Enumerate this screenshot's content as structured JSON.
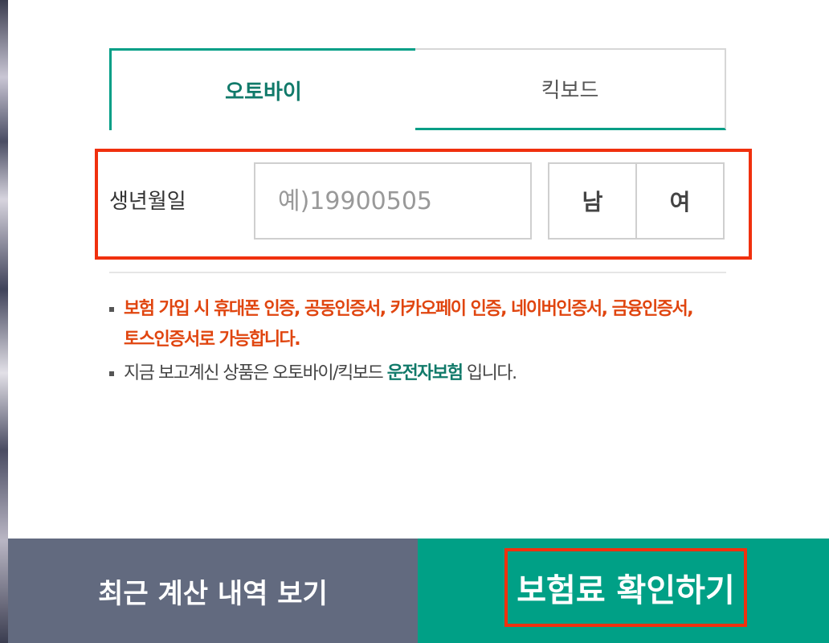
{
  "tabs": [
    {
      "label": "오토바이",
      "active": true
    },
    {
      "label": "킥보드",
      "active": false
    }
  ],
  "birth": {
    "label": "생년월일",
    "placeholder": "예)19900505",
    "value": ""
  },
  "gender": {
    "options": [
      "남",
      "여"
    ]
  },
  "notes": {
    "auth_line1": "보험 가입 시 휴대폰 인증, 공동인증서, 카카오페이 인증, 네이버인증서, 금융인증서,",
    "auth_line2": "토스인증서로 가능합니다.",
    "product_prefix": "지금 보고계신 상품은 오토바이/킥보드 ",
    "product_emphasis": "운전자보험",
    "product_suffix": " 입니다."
  },
  "buttons": {
    "history": "최근 계산 내역 보기",
    "confirm": "보험료 확인하기"
  },
  "colors": {
    "accent_green": "#00a086",
    "alert_orange": "#e0450f",
    "highlight_red": "#f0300e",
    "history_gray": "#626a7f"
  }
}
